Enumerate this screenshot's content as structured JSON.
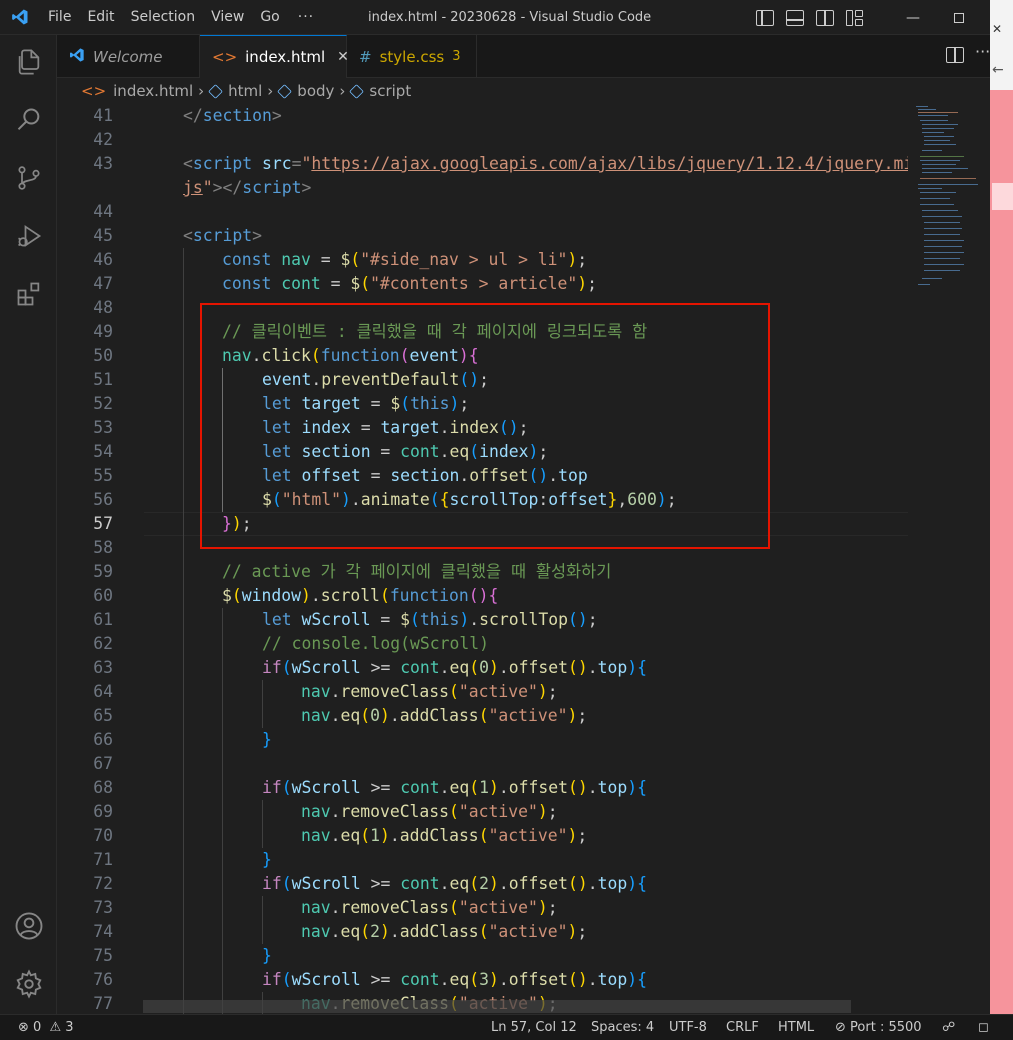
{
  "window": {
    "title": "index.html - 20230628 - Visual Studio Code",
    "menu": [
      "File",
      "Edit",
      "Selection",
      "View",
      "Go"
    ],
    "menu_more": "···"
  },
  "tabs": [
    {
      "label": "Welcome",
      "icon": "vscode-icon"
    },
    {
      "label": "index.html",
      "icon": "html-icon",
      "close": "✕"
    },
    {
      "label": "style.css",
      "icon": "css-hash-icon",
      "badge": "3"
    }
  ],
  "breadcrumb": [
    "index.html",
    "html",
    "body",
    "script"
  ],
  "editor": {
    "current_line": 57,
    "lines": [
      {
        "n": "41"
      },
      {
        "n": "42"
      },
      {
        "n": "43"
      },
      {
        "n": ""
      },
      {
        "n": "44"
      },
      {
        "n": "45"
      },
      {
        "n": "46"
      },
      {
        "n": "47"
      },
      {
        "n": "48"
      },
      {
        "n": "49"
      },
      {
        "n": "50"
      },
      {
        "n": "51"
      },
      {
        "n": "52"
      },
      {
        "n": "53"
      },
      {
        "n": "54"
      },
      {
        "n": "55"
      },
      {
        "n": "56"
      },
      {
        "n": "57"
      },
      {
        "n": "58"
      },
      {
        "n": "59"
      },
      {
        "n": "60"
      },
      {
        "n": "61"
      },
      {
        "n": "62"
      },
      {
        "n": "63"
      },
      {
        "n": "64"
      },
      {
        "n": "65"
      },
      {
        "n": "66"
      },
      {
        "n": "67"
      },
      {
        "n": "68"
      },
      {
        "n": "69"
      },
      {
        "n": "70"
      },
      {
        "n": "71"
      },
      {
        "n": "72"
      },
      {
        "n": "73"
      },
      {
        "n": "74"
      },
      {
        "n": "75"
      },
      {
        "n": "76"
      },
      {
        "n": "77"
      }
    ],
    "text": {
      "section_close": "section",
      "script_src_url": "https://ajax.googleapis.com/ajax/libs/jquery/1.12.4/jquery.mi",
      "script_src_end": "js",
      "nav_selector": "\"#side_nav > ul > li\"",
      "cont_selector": "\"#contents > article\"",
      "comment_click": "// 클릭이벤트 : 클릭했을 때 각 페이지에 링크되도록 함",
      "comment_active": "// active 가 각 페이지에 클릭했을 때 활성화하기",
      "comment_console": "// console.log(wScroll)",
      "html_str": "\"html\"",
      "active_str": "\"active\"",
      "duration": "600"
    }
  },
  "status": {
    "errors": "0",
    "warnings": "3",
    "position": "Ln 57, Col 12",
    "spaces": "Spaces: 4",
    "encoding": "UTF-8",
    "eol": "CRLF",
    "language": "HTML",
    "port": "Port : 5500"
  }
}
